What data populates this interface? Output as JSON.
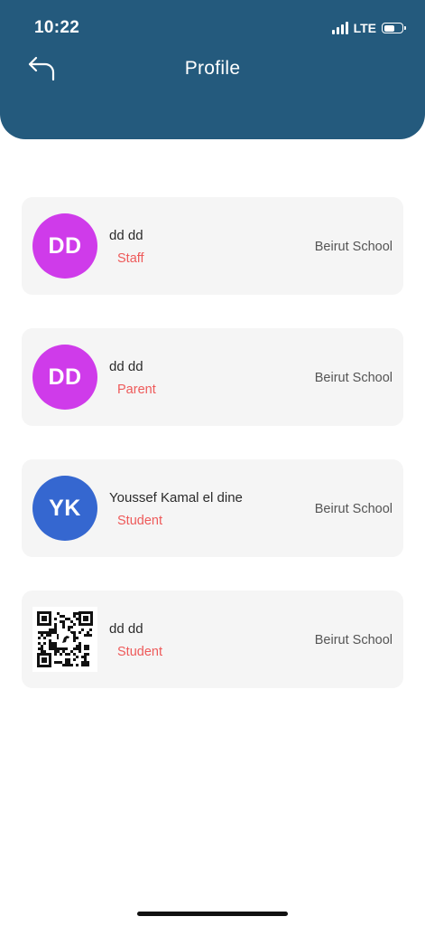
{
  "status_bar": {
    "time": "10:22",
    "network": "LTE"
  },
  "header": {
    "title": "Profile",
    "back_icon": "back-arrow-icon"
  },
  "colors": {
    "header_bg": "#245a7d",
    "role_text": "#ee5a5a",
    "card_bg": "#f5f5f5",
    "avatar_purple": "#cf3bea",
    "avatar_blue": "#3567d0"
  },
  "profiles": [
    {
      "initials": "DD",
      "name": "dd dd",
      "role": "Staff",
      "school": "Beirut School",
      "avatar_color": "#cf3bea"
    },
    {
      "initials": "DD",
      "name": "dd dd",
      "role": "Parent",
      "school": "Beirut School",
      "avatar_color": "#cf3bea"
    },
    {
      "initials": "YK",
      "name": "Youssef Kamal el dine",
      "role": "Student",
      "school": "Beirut School",
      "avatar_color": "#3567d0"
    },
    {
      "initials": "",
      "name": "dd dd",
      "role": "Student",
      "school": "Beirut School",
      "avatar_icon": "qr-code-icon"
    }
  ]
}
